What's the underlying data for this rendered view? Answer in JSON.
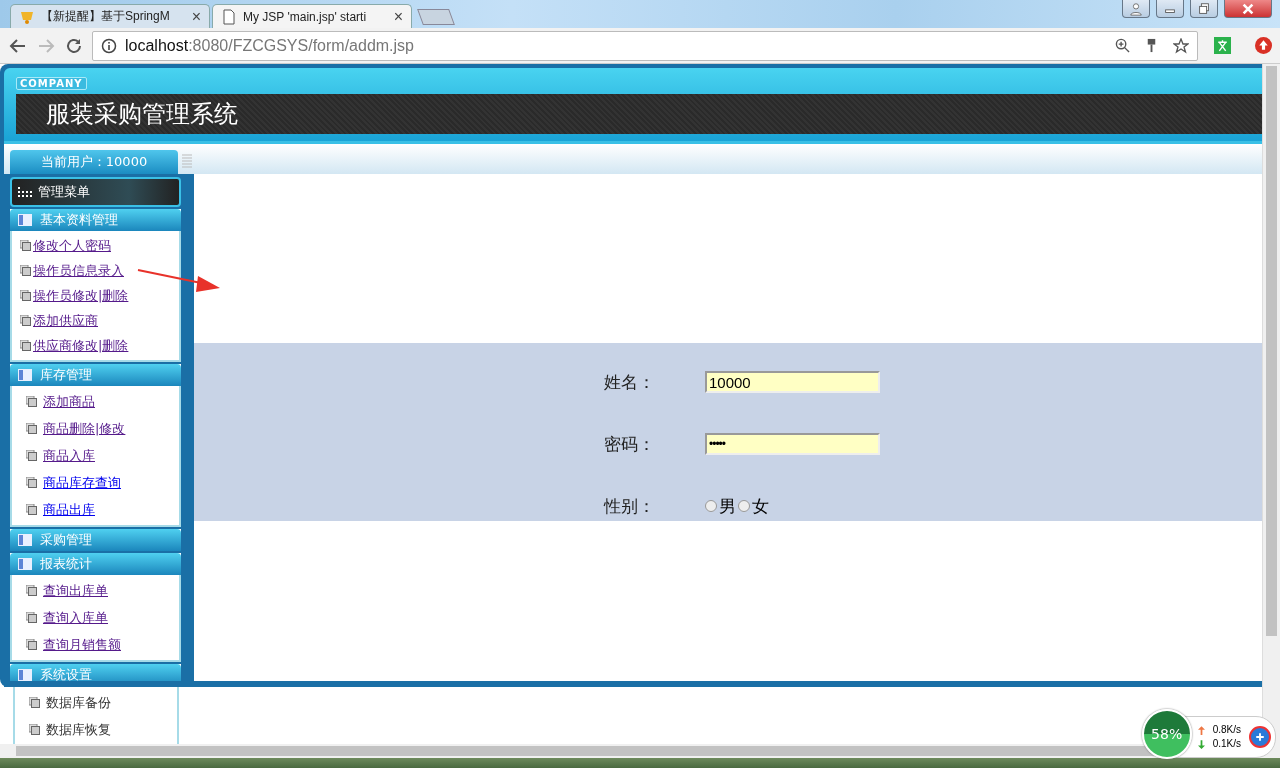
{
  "browser": {
    "tabs": [
      {
        "title": "【新提醒】基于SpringM",
        "selected": false
      },
      {
        "title": "My JSP 'main.jsp' starti",
        "selected": true
      }
    ],
    "close_glyph": "×",
    "url": {
      "host": "localhost",
      "path": ":8080/FZCGSYS/form/addm.jsp"
    }
  },
  "header": {
    "badge": "COMPANY",
    "title": "服装采购管理系统",
    "current_user": "当前用户：10000"
  },
  "menu": {
    "title": "管理菜单",
    "sections": [
      {
        "title": "基本资料管理",
        "expanded": true,
        "items": [
          {
            "label": "修改个人密码",
            "kind": "link",
            "visited": true
          },
          {
            "label": "操作员信息录入",
            "kind": "link",
            "visited": true
          },
          {
            "label": "操作员修改|删除",
            "kind": "link",
            "visited": true
          },
          {
            "label": "添加供应商",
            "kind": "link",
            "visited": true
          },
          {
            "label": "供应商修改|删除",
            "kind": "link",
            "visited": true
          }
        ]
      },
      {
        "title": "库存管理",
        "expanded": true,
        "items": [
          {
            "label": "添加商品",
            "kind": "link",
            "visited": true
          },
          {
            "label": "商品删除|修改",
            "kind": "link",
            "visited": true
          },
          {
            "label": "商品入库",
            "kind": "link",
            "visited": true
          },
          {
            "label": "商品库存查询",
            "kind": "link",
            "visited": false
          },
          {
            "label": "商品出库",
            "kind": "link",
            "visited": false
          }
        ]
      },
      {
        "title": "采购管理",
        "expanded": false
      },
      {
        "title": "报表统计",
        "expanded": true,
        "items": [
          {
            "label": "查询出库单",
            "kind": "link",
            "visited": true
          },
          {
            "label": "查询入库单",
            "kind": "link",
            "visited": true
          },
          {
            "label": "查询月销售额",
            "kind": "link",
            "visited": true
          }
        ]
      }
    ],
    "overflow_section": {
      "title": "系统设置",
      "items": [
        {
          "label": "数据库备份",
          "kind": "plain"
        },
        {
          "label": "数据库恢复",
          "kind": "plain"
        }
      ]
    }
  },
  "form": {
    "fields": [
      {
        "label": "姓名：",
        "kind": "text",
        "value": "10000"
      },
      {
        "label": "密码：",
        "kind": "password",
        "value": "•••••"
      },
      {
        "label": "性别：",
        "kind": "radio",
        "options": [
          {
            "label": "男",
            "checked": false
          },
          {
            "label": "女",
            "checked": false
          }
        ]
      }
    ]
  },
  "net_widget": {
    "percent": "58%",
    "up": "0.8K/s",
    "down": "0.1K/s"
  }
}
